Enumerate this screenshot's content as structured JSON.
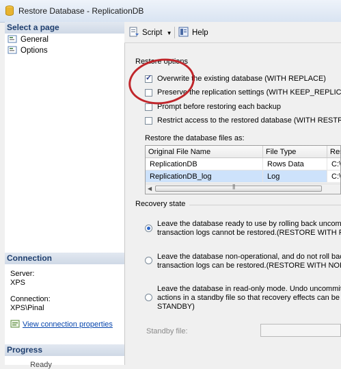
{
  "window": {
    "title": "Restore Database - ReplicationDB",
    "icon": "database-icon"
  },
  "left_pane": {
    "select_page_heading": "Select a page",
    "pages": [
      {
        "label": "General",
        "icon": "page-icon"
      },
      {
        "label": "Options",
        "icon": "page-icon"
      }
    ],
    "connection_heading": "Connection",
    "server_label": "Server:",
    "server_value": "XPS",
    "connection_label": "Connection:",
    "connection_value": "XPS\\Pinal",
    "view_connection_link": "View connection properties",
    "progress_heading": "Progress",
    "progress_status": "Ready"
  },
  "toolbar": {
    "script_label": "Script",
    "help_label": "Help"
  },
  "restore_options": {
    "heading": "Restore options",
    "checkboxes": [
      {
        "label": "Overwrite the existing database (WITH REPLACE)",
        "checked": true
      },
      {
        "label": "Preserve the replication settings (WITH KEEP_REPLICATION)",
        "checked": false
      },
      {
        "label": "Prompt before restoring each backup",
        "checked": false
      },
      {
        "label": "Restrict access to the restored database (WITH RESTRICTED_USER)",
        "checked": false
      }
    ]
  },
  "files": {
    "heading": "Restore the database files as:",
    "columns": [
      "Original File Name",
      "File Type",
      "Restore As"
    ],
    "rows": [
      {
        "name": "ReplicationDB",
        "type": "Rows Data",
        "restore_as": "C:\\"
      },
      {
        "name": "ReplicationDB_log",
        "type": "Log",
        "restore_as": "C:\\"
      }
    ]
  },
  "recovery": {
    "heading": "Recovery state",
    "options": [
      {
        "line1": "Leave the database ready to use by rolling back uncommitted",
        "line2": "transaction logs cannot be restored.(RESTORE WITH RECOVERY)",
        "line3": "",
        "selected": true
      },
      {
        "line1": "Leave the database non-operational, and do not roll back",
        "line2": "transaction logs can be restored.(RESTORE WITH NORECOVERY)",
        "line3": "",
        "selected": false
      },
      {
        "line1": "Leave the database in read-only mode. Undo uncommitted",
        "line2": "actions in a standby file so that recovery effects can be reversed",
        "line3": "STANDBY)",
        "selected": false
      }
    ],
    "standby_label": "Standby file:",
    "standby_value": ""
  },
  "colors": {
    "annotation_circle": "#c0262b",
    "selected_row": "#cde2fb",
    "link": "#0645ad"
  }
}
